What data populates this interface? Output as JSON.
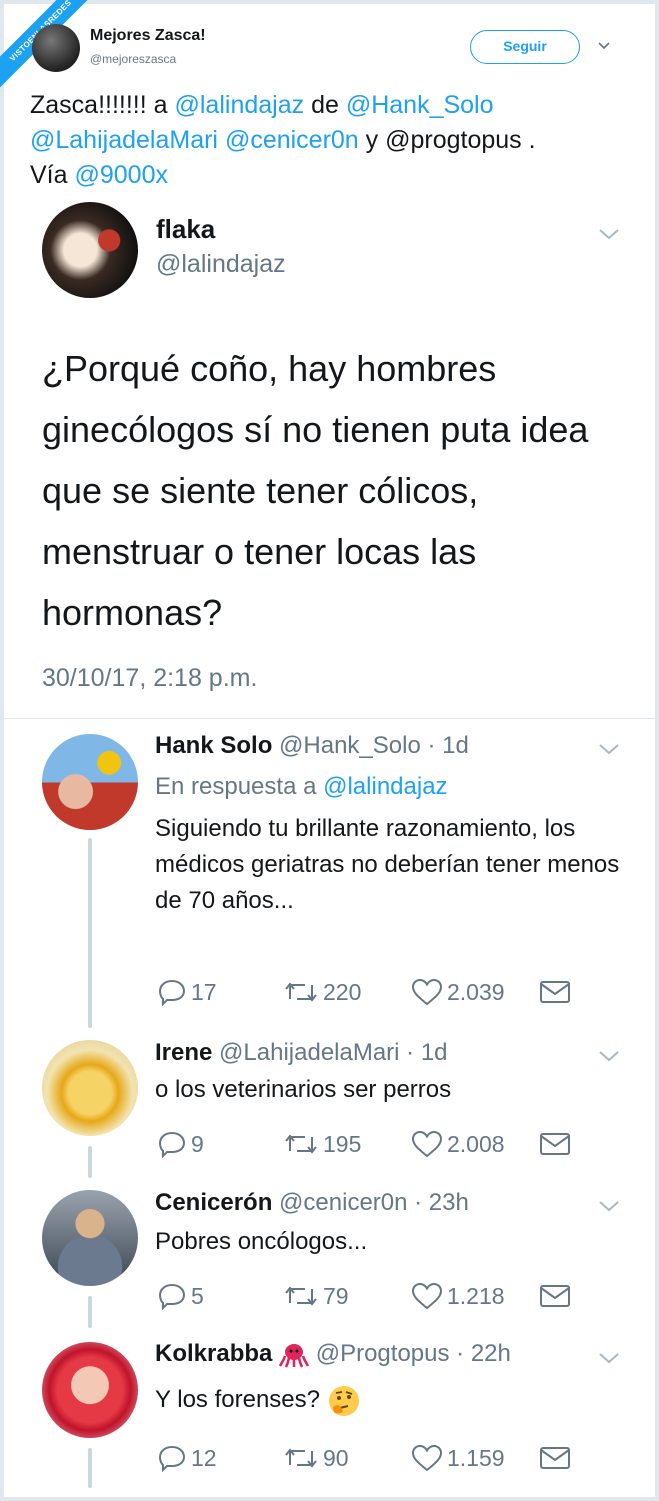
{
  "watermark": "VISTOENLASREDES",
  "header": {
    "name": "Mejores Zasca!",
    "handle": "@mejoreszasca",
    "follow_label": "Seguir"
  },
  "tweet": {
    "p1": "Zasca!!!!!!! a ",
    "m1": "@lalindajaz",
    "p2": " de ",
    "m2": "@Hank_Solo",
    "m3": "@LahijadelaMari",
    "p3": " ",
    "m4": "@cenicer0n",
    "p4": " y @progtopus .",
    "p5": "Vía ",
    "m5": "@9000x"
  },
  "quoted": {
    "name": "flaka",
    "handle": "@lalindajaz",
    "text": "¿Porqué coño, hay hombres ginecólogos sí no tienen puta idea que se siente tener cólicos, menstruar o tener locas las hormonas?",
    "date": "30/10/17, 2:18 p.m."
  },
  "replies": [
    {
      "name": "Hank Solo",
      "handle": "@Hank_Solo · 1d",
      "reply_to_label": "En respuesta a ",
      "reply_to_handle": "@lalindajaz",
      "text": "Siguiendo tu brillante razonamiento, los médicos geriatras no deberían tener menos de 70 años...",
      "replies": "17",
      "retweets": "220",
      "likes": "2.039"
    },
    {
      "name": "Irene",
      "handle": "@LahijadelaMari · 1d",
      "text": "o los veterinarios ser perros",
      "replies": "9",
      "retweets": "195",
      "likes": "2.008"
    },
    {
      "name": "Cenicerón",
      "handle": "@cenicer0n · 23h",
      "text": "Pobres oncólogos...",
      "replies": "5",
      "retweets": "79",
      "likes": "1.218"
    },
    {
      "name": "Kolkrabba",
      "handle": "@Progtopus · 22h",
      "text": "Y los forenses?",
      "replies": "12",
      "retweets": "90",
      "likes": "1.159"
    }
  ],
  "colors": {
    "accent": "#1da1f2",
    "muted": "#657786",
    "line": "#ccd6dd"
  },
  "icons": [
    "reply-icon",
    "retweet-icon",
    "like-icon",
    "dm-icon",
    "chevron-down-icon",
    "octopus-emoji",
    "thinking-emoji"
  ]
}
